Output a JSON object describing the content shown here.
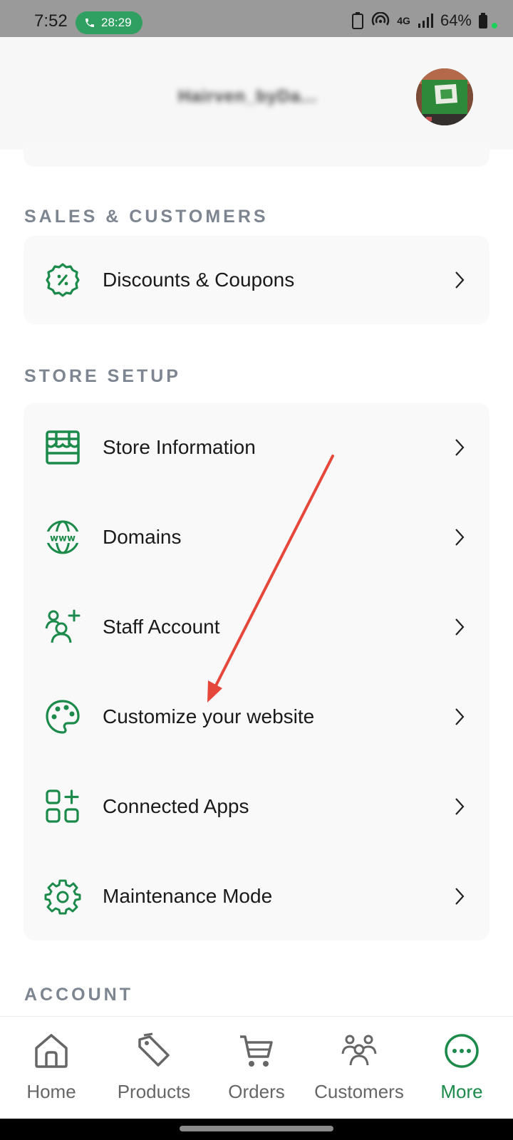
{
  "status_bar": {
    "time": "7:52",
    "call_timer": "28:29",
    "network": "4G",
    "battery": "64%"
  },
  "header": {
    "store_name": "Hairven_byDa..."
  },
  "sections": {
    "sales": {
      "title": "SALES & CUSTOMERS",
      "items": [
        {
          "label": "Discounts & Coupons",
          "icon": "discount-icon"
        }
      ]
    },
    "store_setup": {
      "title": "STORE SETUP",
      "items": [
        {
          "label": "Store Information",
          "icon": "storefront-icon"
        },
        {
          "label": "Domains",
          "icon": "globe-www-icon"
        },
        {
          "label": "Staff Account",
          "icon": "add-user-icon"
        },
        {
          "label": "Customize your website",
          "icon": "palette-icon"
        },
        {
          "label": "Connected Apps",
          "icon": "apps-icon"
        },
        {
          "label": "Maintenance Mode",
          "icon": "gear-icon"
        }
      ]
    },
    "account": {
      "title": "ACCOUNT"
    }
  },
  "bottom_nav": {
    "items": [
      {
        "label": "Home",
        "icon": "home-icon"
      },
      {
        "label": "Products",
        "icon": "tag-icon"
      },
      {
        "label": "Orders",
        "icon": "cart-icon"
      },
      {
        "label": "Customers",
        "icon": "customers-icon"
      },
      {
        "label": "More",
        "icon": "more-icon",
        "active": true
      }
    ]
  },
  "colors": {
    "accent": "#1c8a4a",
    "annotation_arrow": "#e5473b"
  }
}
